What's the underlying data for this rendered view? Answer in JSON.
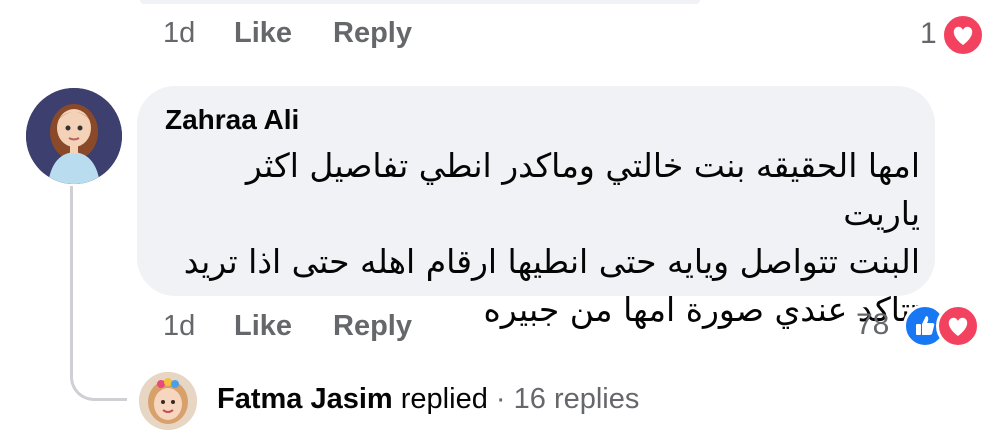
{
  "prev_comment": {
    "time": "1d",
    "like_label": "Like",
    "reply_label": "Reply",
    "reaction_count": "1",
    "reaction_icons": [
      "heart-icon"
    ]
  },
  "comment": {
    "author": "Zahraa Ali",
    "lines": [
      "امها الحقيقه بنت خالتي وماكدر انطي تفاصيل اكثر ياريت",
      "البنت تتواصل ويايه حتى انطيها ارقام اهله حتى اذا تريد",
      "تتاكد عندي صورة امها من جبيره"
    ],
    "time": "1d",
    "like_label": "Like",
    "reply_label": "Reply",
    "reaction_count": "78",
    "reaction_icons": [
      "like-icon",
      "heart-icon"
    ]
  },
  "replies": {
    "author": "Fatma Jasim",
    "action": "replied",
    "separator": "·",
    "count_text": "16 replies"
  },
  "colors": {
    "meta_text": "#65676b",
    "bubble_bg": "#f0f2f5",
    "love": "#f3425f",
    "like": "#1877f2"
  }
}
